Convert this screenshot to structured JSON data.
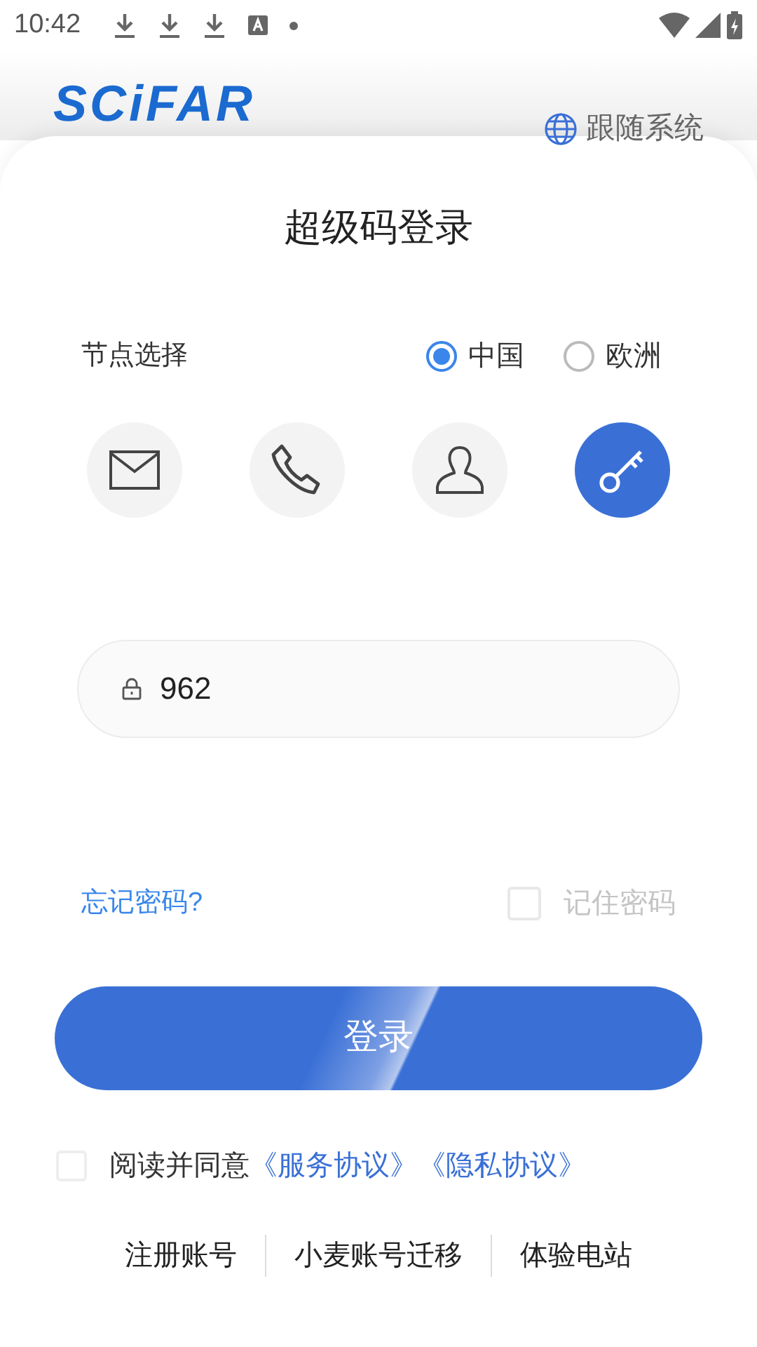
{
  "status_bar": {
    "time": "10:42",
    "notification_icons": [
      {
        "kind": "download"
      },
      {
        "kind": "download"
      },
      {
        "kind": "download"
      },
      {
        "kind": "font"
      },
      {
        "kind": "dot"
      }
    ]
  },
  "header": {
    "logo": "SCiFAR",
    "language": "跟随系统"
  },
  "title": "超级码登录",
  "node": {
    "label": "节点选择",
    "options": [
      {
        "label": "中国",
        "selected": true
      },
      {
        "label": "欧洲",
        "selected": false
      }
    ]
  },
  "login_methods": [
    {
      "kind": "mail",
      "selected": false
    },
    {
      "kind": "phone",
      "selected": false
    },
    {
      "kind": "user",
      "selected": false
    },
    {
      "kind": "key",
      "selected": true
    }
  ],
  "code_field": {
    "value": "962"
  },
  "forgot_password": "忘记密码?",
  "remember_password": {
    "label": "记住密码",
    "checked": false
  },
  "login_button": "登录",
  "agreement": {
    "checked": false,
    "text": "阅读并同意",
    "links": [
      "《服务协议》",
      "《隐私协议》"
    ]
  },
  "footer_links": [
    "注册账号",
    "小麦账号迁移",
    "体验电站"
  ]
}
